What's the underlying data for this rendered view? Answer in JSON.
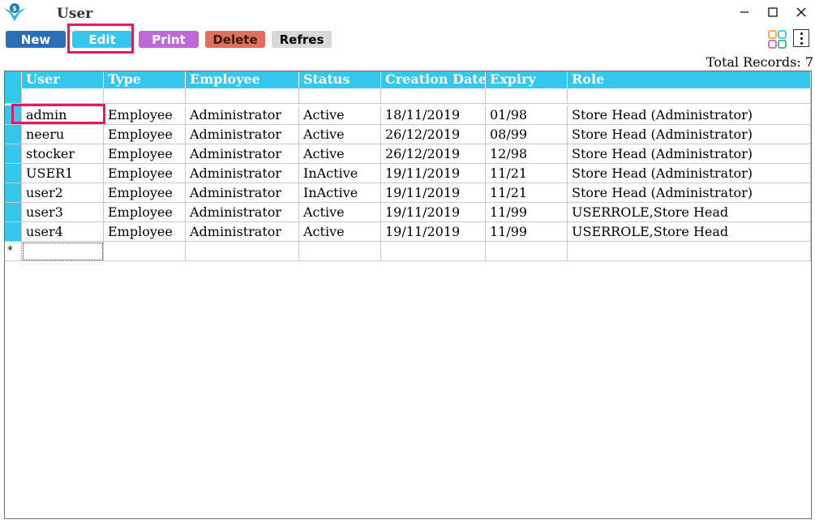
{
  "window": {
    "title": "User"
  },
  "toolbar": {
    "new_label": "New",
    "edit_label": "Edit",
    "print_label": "Print",
    "delete_label": "Delete",
    "refresh_label": "Refres"
  },
  "summary": {
    "total_label": "Total Records: 7"
  },
  "grid": {
    "columns": [
      "User",
      "Type",
      "Employee",
      "Status",
      "Creation Date",
      "Expiry",
      "Role"
    ],
    "rows": [
      [
        "admin",
        "Employee",
        "Administrator",
        "Active",
        "18/11/2019",
        "01/98",
        "Store Head (Administrator)"
      ],
      [
        "neeru",
        "Employee",
        "Administrator",
        "Active",
        "26/12/2019",
        "08/99",
        "Store Head (Administrator)"
      ],
      [
        "stocker",
        "Employee",
        "Administrator",
        "Active",
        "26/12/2019",
        "12/98",
        "Store Head (Administrator)"
      ],
      [
        "USER1",
        "Employee",
        "Administrator",
        "InActive",
        "19/11/2019",
        "11/21",
        "Store Head (Administrator)"
      ],
      [
        "user2",
        "Employee",
        "Administrator",
        "InActive",
        "19/11/2019",
        "11/21",
        "Store Head (Administrator)"
      ],
      [
        "user3",
        "Employee",
        "Administrator",
        "Active",
        "19/11/2019",
        "11/99",
        "USERROLE,Store Head"
      ],
      [
        "user4",
        "Employee",
        "Administrator",
        "Active",
        "19/11/2019",
        "11/99",
        "USERROLE,Store Head"
      ]
    ],
    "new_row_marker": "*"
  },
  "colors": {
    "header": "#36c6ec",
    "new": "#2a6fb6",
    "edit": "#36c6ec",
    "print": "#bc6bd4",
    "delete": "#e0705e",
    "refresh": "#d8d8d8",
    "highlight": "#e8185c"
  },
  "icons": {
    "logo": "app-logo-icon",
    "layout": "layout-grid-icon",
    "more": "more-vertical-icon"
  }
}
